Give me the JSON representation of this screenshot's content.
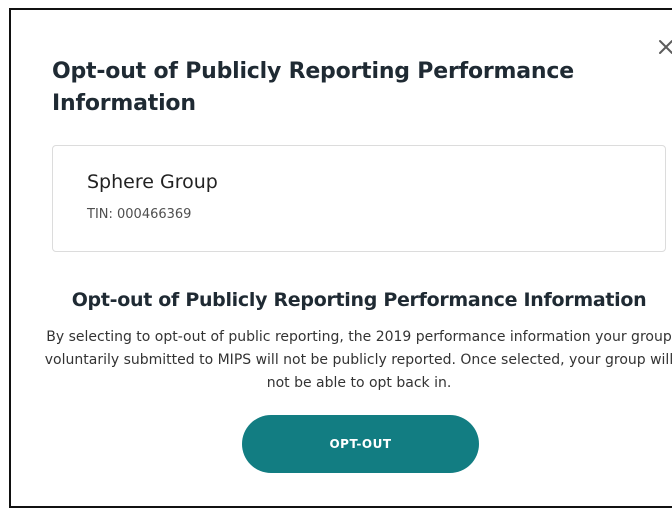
{
  "modal": {
    "title": "Opt-out of Publicly Reporting Performance Information",
    "close_icon": "close-icon"
  },
  "group": {
    "name": "Sphere Group",
    "tin": "TIN: 000466369"
  },
  "section": {
    "title": "Opt-out of Publicly Reporting Performance Information",
    "body": "By selecting to opt-out of public reporting, the 2019 performance information your group voluntarily submitted to MIPS will not be publicly reported. Once selected, your group will not be able to opt back in."
  },
  "actions": {
    "optout_label": "OPT-OUT"
  },
  "colors": {
    "accent": "#127d82",
    "border": "#dcdcdc",
    "text": "#1f2a33"
  }
}
